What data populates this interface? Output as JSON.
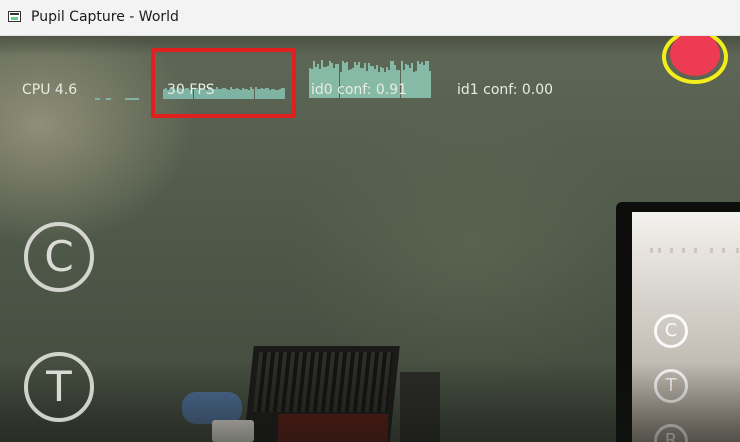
{
  "window": {
    "title": "Pupil Capture - World"
  },
  "hud": {
    "cpu_label": "CPU 4.6",
    "fps_label": "30 FPS",
    "conf0_label": "id0 conf: 0.91",
    "conf1_label": "id1 conf: 0.00"
  },
  "buttons": {
    "calibrate_glyph": "C",
    "test_glyph": "T"
  },
  "mini_display": {
    "calibrate_glyph": "C",
    "test_glyph": "T",
    "record_glyph": "R"
  },
  "colors": {
    "record_dot": "#ec3b52",
    "record_ring": "#f2ee1a",
    "highlight_box": "#e0201e",
    "graph": "#7fb3a3"
  }
}
